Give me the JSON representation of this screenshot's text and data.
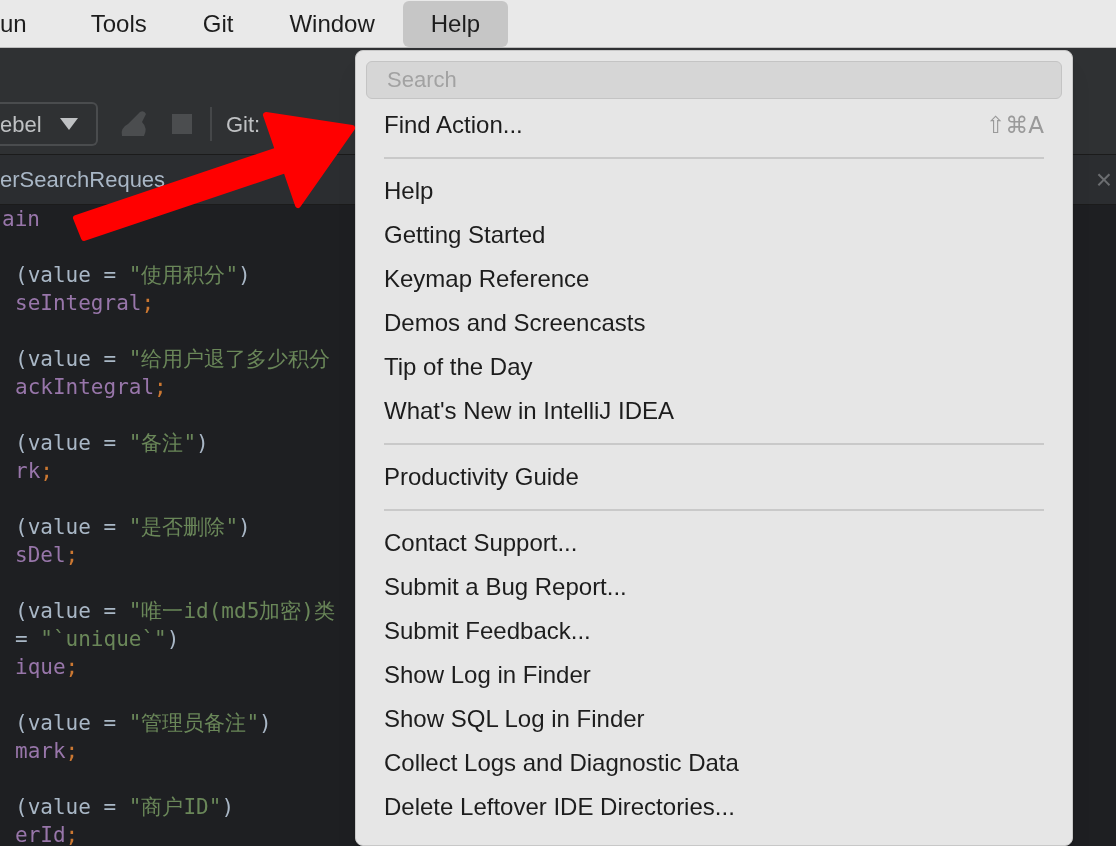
{
  "menu_bar": {
    "items": [
      {
        "label": "un",
        "selected": false
      },
      {
        "label": "Tools",
        "selected": false
      },
      {
        "label": "Git",
        "selected": false
      },
      {
        "label": "Window",
        "selected": false
      },
      {
        "label": "Help",
        "selected": true
      }
    ]
  },
  "toolbar": {
    "run_config": "ebel",
    "git_label": "Git:"
  },
  "editor_tab": {
    "label": "erSearchReques"
  },
  "code_lines": [
    {
      "kind": "code",
      "segments": [
        {
          "kind": "field",
          "text": "ain"
        }
      ]
    },
    {
      "kind": "blank"
    },
    {
      "kind": "code",
      "segments": [
        {
          "kind": "plain",
          "text": "(value = "
        },
        {
          "kind": "string",
          "text": "\"使用积分\""
        },
        {
          "kind": "plain",
          "text": ")"
        }
      ]
    },
    {
      "kind": "code",
      "segments": [
        {
          "kind": "field",
          "text": "seIntegral"
        },
        {
          "kind": "semi",
          "text": ";"
        }
      ]
    },
    {
      "kind": "blank"
    },
    {
      "kind": "code",
      "segments": [
        {
          "kind": "plain",
          "text": "(value = "
        },
        {
          "kind": "string",
          "text": "\"给用户退了多少积分"
        }
      ]
    },
    {
      "kind": "code",
      "segments": [
        {
          "kind": "field",
          "text": "ackIntegral"
        },
        {
          "kind": "semi",
          "text": ";"
        }
      ]
    },
    {
      "kind": "blank"
    },
    {
      "kind": "code",
      "segments": [
        {
          "kind": "plain",
          "text": "(value = "
        },
        {
          "kind": "string",
          "text": "\"备注\""
        },
        {
          "kind": "plain",
          "text": ")"
        }
      ]
    },
    {
      "kind": "code",
      "segments": [
        {
          "kind": "field",
          "text": "rk"
        },
        {
          "kind": "semi",
          "text": ";"
        }
      ]
    },
    {
      "kind": "blank"
    },
    {
      "kind": "code",
      "segments": [
        {
          "kind": "plain",
          "text": "(value = "
        },
        {
          "kind": "string",
          "text": "\"是否删除\""
        },
        {
          "kind": "plain",
          "text": ")"
        }
      ]
    },
    {
      "kind": "code",
      "segments": [
        {
          "kind": "field",
          "text": "sDel"
        },
        {
          "kind": "semi",
          "text": ";"
        }
      ]
    },
    {
      "kind": "blank"
    },
    {
      "kind": "code",
      "segments": [
        {
          "kind": "plain",
          "text": "(value = "
        },
        {
          "kind": "string",
          "text": "\"唯一id(md5加密)类"
        }
      ]
    },
    {
      "kind": "code",
      "segments": [
        {
          "kind": "plain",
          "text": "= "
        },
        {
          "kind": "string",
          "text": "\"`unique`\""
        },
        {
          "kind": "plain",
          "text": ")"
        }
      ]
    },
    {
      "kind": "code",
      "segments": [
        {
          "kind": "field",
          "text": "ique"
        },
        {
          "kind": "semi",
          "text": ";"
        }
      ]
    },
    {
      "kind": "blank"
    },
    {
      "kind": "code",
      "segments": [
        {
          "kind": "plain",
          "text": "(value = "
        },
        {
          "kind": "string",
          "text": "\"管理员备注\""
        },
        {
          "kind": "plain",
          "text": ")"
        }
      ]
    },
    {
      "kind": "code",
      "segments": [
        {
          "kind": "field",
          "text": "mark"
        },
        {
          "kind": "semi",
          "text": ";"
        }
      ]
    },
    {
      "kind": "blank"
    },
    {
      "kind": "code",
      "segments": [
        {
          "kind": "plain",
          "text": "(value = "
        },
        {
          "kind": "string",
          "text": "\"商户ID\""
        },
        {
          "kind": "plain",
          "text": ")"
        }
      ]
    },
    {
      "kind": "code",
      "segments": [
        {
          "kind": "field",
          "text": "erId"
        },
        {
          "kind": "semi",
          "text": ";"
        }
      ]
    }
  ],
  "help_menu": {
    "search": {
      "placeholder": "Search"
    },
    "items": [
      {
        "kind": "item",
        "label": "Find Action...",
        "shortcut": "⇧⌘A"
      },
      {
        "kind": "separator"
      },
      {
        "kind": "item",
        "label": "Help"
      },
      {
        "kind": "item",
        "label": "Getting Started"
      },
      {
        "kind": "item",
        "label": "Keymap Reference"
      },
      {
        "kind": "item",
        "label": "Demos and Screencasts"
      },
      {
        "kind": "item",
        "label": "Tip of the Day"
      },
      {
        "kind": "item",
        "label": "What's New in IntelliJ IDEA"
      },
      {
        "kind": "separator"
      },
      {
        "kind": "item",
        "label": "Productivity Guide"
      },
      {
        "kind": "separator"
      },
      {
        "kind": "item",
        "label": "Contact Support..."
      },
      {
        "kind": "item",
        "label": "Submit a Bug Report..."
      },
      {
        "kind": "item",
        "label": "Submit Feedback..."
      },
      {
        "kind": "item",
        "label": "Show Log in Finder"
      },
      {
        "kind": "item",
        "label": "Show SQL Log in Finder"
      },
      {
        "kind": "item",
        "label": "Collect Logs and Diagnostic Data"
      },
      {
        "kind": "item",
        "label": "Delete Leftover IDE Directories..."
      }
    ]
  },
  "close_tab": "×"
}
